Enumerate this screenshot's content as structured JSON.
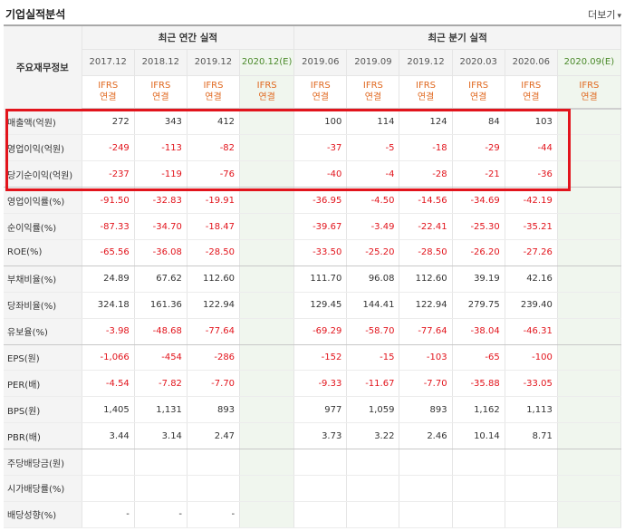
{
  "header": {
    "title": "기업실적분석",
    "more_label": "더보기",
    "more_icon": "chevron-down-icon"
  },
  "table": {
    "row_header_label": "주요재무정보",
    "groups": {
      "annual": "최근 연간 실적",
      "quarterly": "최근 분기 실적"
    },
    "columns": [
      "2017.12",
      "2018.12",
      "2019.12",
      "2020.12(E)",
      "2019.06",
      "2019.09",
      "2019.12",
      "2020.03",
      "2020.06",
      "2020.09(E)"
    ],
    "standard_line1": "IFRS",
    "standard_line2": "연결",
    "rows": [
      {
        "label": "매출액(억원)",
        "values": [
          "272",
          "343",
          "412",
          "",
          "100",
          "114",
          "124",
          "84",
          "103",
          ""
        ]
      },
      {
        "label": "영업이익(억원)",
        "values": [
          "-249",
          "-113",
          "-82",
          "",
          "-37",
          "-5",
          "-18",
          "-29",
          "-44",
          ""
        ]
      },
      {
        "label": "당기순이익(억원)",
        "values": [
          "-237",
          "-119",
          "-76",
          "",
          "-40",
          "-4",
          "-28",
          "-21",
          "-36",
          ""
        ]
      },
      {
        "label": "영업이익률(%)",
        "values": [
          "-91.50",
          "-32.83",
          "-19.91",
          "",
          "-36.95",
          "-4.50",
          "-14.56",
          "-34.69",
          "-42.19",
          ""
        ]
      },
      {
        "label": "순이익률(%)",
        "values": [
          "-87.33",
          "-34.70",
          "-18.47",
          "",
          "-39.67",
          "-3.49",
          "-22.41",
          "-25.30",
          "-35.21",
          ""
        ]
      },
      {
        "label": "ROE(%)",
        "values": [
          "-65.56",
          "-36.08",
          "-28.50",
          "",
          "-33.50",
          "-25.20",
          "-28.50",
          "-26.20",
          "-27.26",
          ""
        ]
      },
      {
        "label": "부채비율(%)",
        "values": [
          "24.89",
          "67.62",
          "112.60",
          "",
          "111.70",
          "96.08",
          "112.60",
          "39.19",
          "42.16",
          ""
        ]
      },
      {
        "label": "당좌비율(%)",
        "values": [
          "324.18",
          "161.36",
          "122.94",
          "",
          "129.45",
          "144.41",
          "122.94",
          "279.75",
          "239.40",
          ""
        ]
      },
      {
        "label": "유보율(%)",
        "values": [
          "-3.98",
          "-48.68",
          "-77.64",
          "",
          "-69.29",
          "-58.70",
          "-77.64",
          "-38.04",
          "-46.31",
          ""
        ]
      },
      {
        "label": "EPS(원)",
        "values": [
          "-1,066",
          "-454",
          "-286",
          "",
          "-152",
          "-15",
          "-103",
          "-65",
          "-100",
          ""
        ]
      },
      {
        "label": "PER(배)",
        "values": [
          "-4.54",
          "-7.82",
          "-7.70",
          "",
          "-9.33",
          "-11.67",
          "-7.70",
          "-35.88",
          "-33.05",
          ""
        ]
      },
      {
        "label": "BPS(원)",
        "values": [
          "1,405",
          "1,131",
          "893",
          "",
          "977",
          "1,059",
          "893",
          "1,162",
          "1,113",
          ""
        ]
      },
      {
        "label": "PBR(배)",
        "values": [
          "3.44",
          "3.14",
          "2.47",
          "",
          "3.73",
          "3.22",
          "2.46",
          "10.14",
          "8.71",
          ""
        ]
      },
      {
        "label": "주당배당금(원)",
        "values": [
          "",
          "",
          "",
          "",
          "",
          "",
          "",
          "",
          "",
          ""
        ]
      },
      {
        "label": "시가배당률(%)",
        "values": [
          "",
          "",
          "",
          "",
          "",
          "",
          "",
          "",
          "",
          ""
        ]
      },
      {
        "label": "배당성향(%)",
        "values": [
          "-",
          "-",
          "-",
          "",
          "",
          "",
          "",
          "",
          "",
          ""
        ]
      }
    ],
    "highlight_color": "#e2141c",
    "negative_color": "#e2141c",
    "estimate_color": "#4a8a2a",
    "standard_color": "#e0681f"
  }
}
